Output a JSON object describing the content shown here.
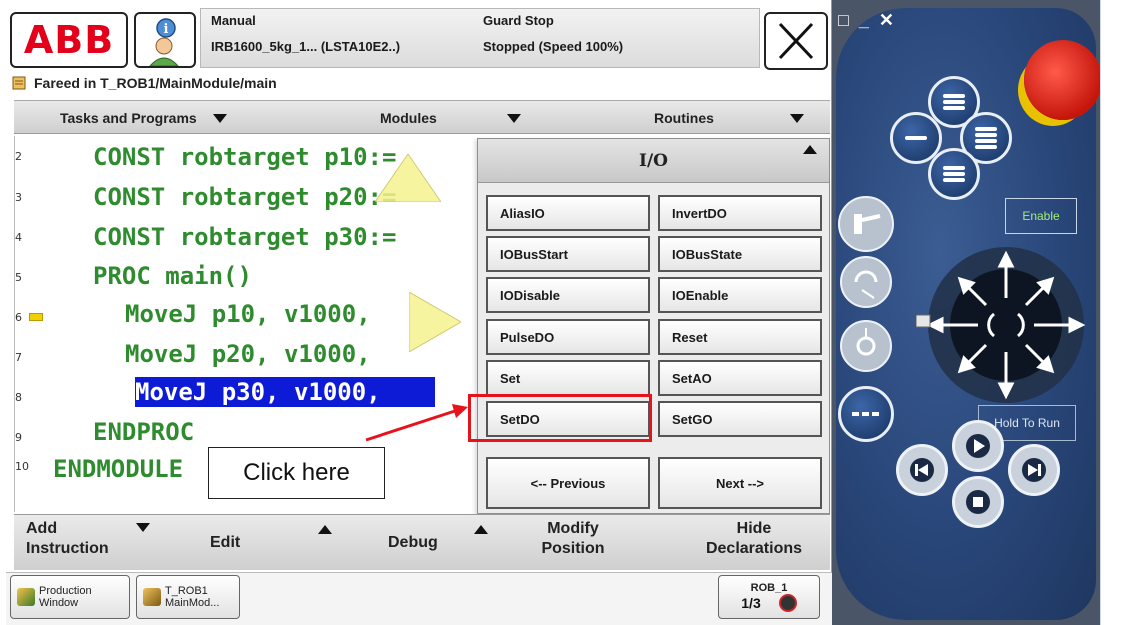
{
  "header": {
    "mode": "Manual",
    "robot": "IRB1600_5kg_1... (LSTA10E2..)",
    "guard": "Guard Stop",
    "state": "Stopped (Speed 100%)",
    "logo_text": "ABB"
  },
  "program_path": "Fareed in T_ROB1/MainModule/main",
  "tabs": [
    {
      "label": "Tasks and Programs"
    },
    {
      "label": "Modules"
    },
    {
      "label": "Routines"
    }
  ],
  "code_lines": [
    {
      "num": "2",
      "text": "CONST robtarget p10:="
    },
    {
      "num": "3",
      "text": "CONST robtarget p20:="
    },
    {
      "num": "4",
      "text": "CONST robtarget p30:="
    },
    {
      "num": "5",
      "text": "PROC main()"
    },
    {
      "num": "6",
      "text": "MoveJ p10, v1000, "
    },
    {
      "num": "7",
      "text": "MoveJ p20, v1000, "
    },
    {
      "num": "8",
      "text": "MoveJ p30, v1000, "
    },
    {
      "num": "9",
      "text": "ENDPROC"
    },
    {
      "num": "10",
      "text": "ENDMODULE"
    }
  ],
  "io_panel": {
    "title": "I/O",
    "buttons": [
      "AliasIO",
      "InvertDO",
      "IOBusStart",
      "IOBusState",
      "IODisable",
      "IOEnable",
      "PulseDO",
      "Reset",
      "Set",
      "SetAO",
      "SetDO",
      "SetGO"
    ],
    "previous": "<-- Previous",
    "next": "Next -->"
  },
  "annotation": {
    "callout": "Click here",
    "color": "#e8121b"
  },
  "bottom_menu": {
    "add_instruction": "Add Instruction",
    "edit": "Edit",
    "debug": "Debug",
    "modify_position": "Modify Position",
    "hide_declarations": "Hide Declarations"
  },
  "taskbar": {
    "production_window_line1": "Production",
    "production_window_line2": "Window",
    "t_rob1_line1": "T_ROB1",
    "t_rob1_line2": "MainMod...",
    "rob_label": "ROB_1",
    "rob_fraction": "1/3"
  },
  "hardware": {
    "enable_label": "Enable",
    "hold_to_run_label": "Hold To Run"
  },
  "colors": {
    "code_green": "#2e8b2e",
    "selection_blue": "#0d1bd6",
    "abb_red": "#e2001a",
    "pendant_blue": "#294679"
  }
}
